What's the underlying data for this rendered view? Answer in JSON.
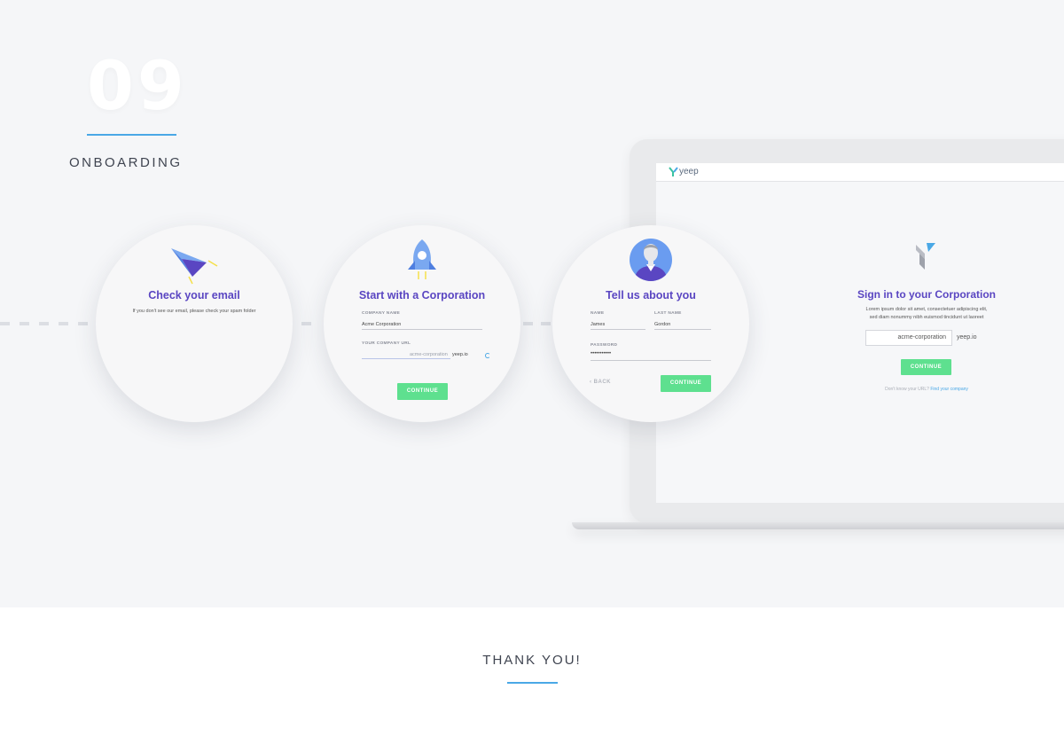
{
  "section": {
    "number": "09",
    "title": "ONBOARDING"
  },
  "footer": {
    "thanks": "THANK YOU!"
  },
  "colors": {
    "accent": "#4aa8e6",
    "title": "#5a46c2",
    "button": "#5ee08f"
  },
  "screens": {
    "check_email": {
      "icon": "paper-plane-icon",
      "title": "Check your email",
      "text": "If you don't see our email, please check your spam folder"
    },
    "corporation": {
      "icon": "rocket-icon",
      "title": "Start with a Corporation",
      "company_name_label": "COMPANY NAME",
      "company_name_value": "Acme Corporation",
      "url_label": "YOUR COMPANY URL",
      "url_value": "acme-corporation",
      "url_suffix": "yeep.io",
      "button": "CONTINUE"
    },
    "about_you": {
      "icon": "user-avatar-icon",
      "title": "Tell us about you",
      "name_label": "NAME",
      "name_value": "James",
      "last_name_label": "LAST NAME",
      "last_name_value": "Gordon",
      "password_label": "PASSWORD",
      "password_value": "•••••••••••",
      "back": "BACK",
      "button": "CONTINUE"
    },
    "sign_in": {
      "logo_text": "yeep",
      "title": "Sign in to your Corporation",
      "text": "Lorem ipsum dolor sit amet, consectetuer adipiscing elit, sed diam nonummy nibh euismod tincidunt ut laoreet",
      "url_value": "acme-corporation",
      "url_suffix": "yeep.io",
      "button": "CONTINUE",
      "help_text": "Don't know your URL?",
      "help_link": "Find your company"
    }
  }
}
